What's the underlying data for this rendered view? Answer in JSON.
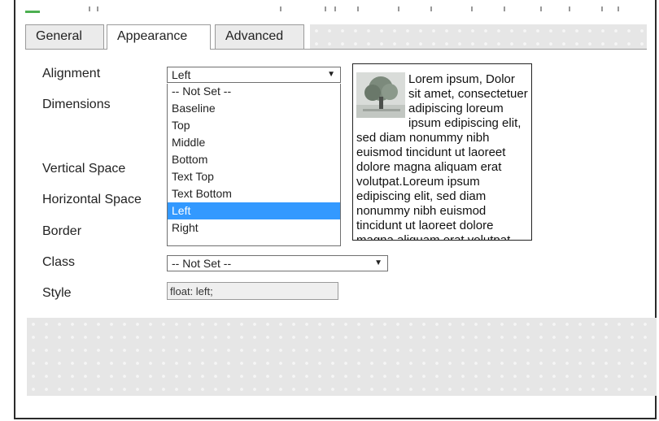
{
  "tabs": [
    {
      "label": "General",
      "active": false
    },
    {
      "label": "Appearance",
      "active": true
    },
    {
      "label": "Advanced",
      "active": false
    }
  ],
  "form": {
    "alignment_label": "Alignment",
    "alignment_value": "Left",
    "dimensions_label": "Dimensions",
    "vertical_space_label": "Vertical Space",
    "horizontal_space_label": "Horizontal Space",
    "border_label": "Border",
    "class_label": "Class",
    "class_value": "-- Not Set --",
    "style_label": "Style",
    "style_value": "float: left;"
  },
  "alignment_options": [
    "-- Not Set --",
    "Baseline",
    "Top",
    "Middle",
    "Bottom",
    "Text Top",
    "Text Bottom",
    "Left",
    "Right"
  ],
  "alignment_selected": "Left",
  "preview_text": "Lorem ipsum, Dolor sit amet, consectetuer adipiscing loreum ipsum edipiscing elit, sed diam nonummy nibh euismod tincidunt ut laoreet dolore magna aliquam erat volutpat.Loreum ipsum edipiscing elit, sed diam nonummy nibh euismod tincidunt ut laoreet dolore magna aliquam erat volutpat.",
  "icons": {
    "dropdown": "triangle-down",
    "preview_image": "tree-thumbnail-icon"
  },
  "colors": {
    "selection": "#3399ff"
  }
}
